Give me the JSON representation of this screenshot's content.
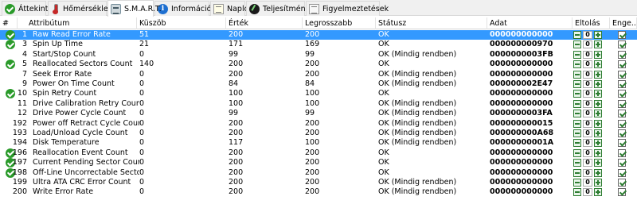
{
  "tabs": [
    {
      "label": "Áttekintés",
      "icon": "check-circle-icon",
      "active": false
    },
    {
      "label": "Hőmérséklet",
      "icon": "thermometer-icon",
      "active": false
    },
    {
      "label": "S.M.A.R.T.",
      "icon": "smart-drive-icon",
      "active": true
    },
    {
      "label": "Információk",
      "icon": "info-icon",
      "active": false
    },
    {
      "label": "Napló",
      "icon": "log-icon",
      "active": false
    },
    {
      "label": "Teljesítmény",
      "icon": "performance-icon",
      "active": false
    },
    {
      "label": "Figyelmeztetések",
      "icon": "warnings-icon",
      "active": false
    }
  ],
  "table": {
    "headers": {
      "num": "#",
      "attr": "Attribútum",
      "threshold": "Küszöb",
      "value": "Érték",
      "worst": "Legrosszabb",
      "status": "Státusz",
      "data": "Adat",
      "offset": "Eltolás",
      "enabled": "Enge..."
    },
    "rows": [
      {
        "ok_icon": true,
        "num": "1",
        "attr": "Raw Read Error Rate",
        "threshold": "51",
        "value": "200",
        "worst": "200",
        "status": "OK",
        "data": "000000000000",
        "offset": "0",
        "enabled": true,
        "selected": true
      },
      {
        "ok_icon": true,
        "num": "3",
        "attr": "Spin Up Time",
        "threshold": "21",
        "value": "171",
        "worst": "169",
        "status": "OK",
        "data": "000000000970",
        "offset": "0",
        "enabled": true
      },
      {
        "ok_icon": false,
        "num": "4",
        "attr": "Start/Stop Count",
        "threshold": "0",
        "value": "99",
        "worst": "99",
        "status": "OK (Mindig rendben)",
        "data": "0000000003FB",
        "offset": "0",
        "enabled": true
      },
      {
        "ok_icon": true,
        "num": "5",
        "attr": "Reallocated Sectors Count",
        "threshold": "140",
        "value": "200",
        "worst": "200",
        "status": "OK",
        "data": "000000000000",
        "offset": "0",
        "enabled": true
      },
      {
        "ok_icon": false,
        "num": "7",
        "attr": "Seek Error Rate",
        "threshold": "0",
        "value": "200",
        "worst": "200",
        "status": "OK (Mindig rendben)",
        "data": "000000000000",
        "offset": "0",
        "enabled": true
      },
      {
        "ok_icon": false,
        "num": "9",
        "attr": "Power On Time Count",
        "threshold": "0",
        "value": "84",
        "worst": "84",
        "status": "OK (Mindig rendben)",
        "data": "000000002E47",
        "offset": "0",
        "enabled": true
      },
      {
        "ok_icon": true,
        "num": "10",
        "attr": "Spin Retry Count",
        "threshold": "0",
        "value": "100",
        "worst": "100",
        "status": "OK",
        "data": "000000000000",
        "offset": "0",
        "enabled": true
      },
      {
        "ok_icon": false,
        "num": "11",
        "attr": "Drive Calibration Retry Count",
        "threshold": "0",
        "value": "100",
        "worst": "100",
        "status": "OK (Mindig rendben)",
        "data": "000000000000",
        "offset": "0",
        "enabled": true
      },
      {
        "ok_icon": false,
        "num": "12",
        "attr": "Drive Power Cycle Count",
        "threshold": "0",
        "value": "99",
        "worst": "99",
        "status": "OK (Mindig rendben)",
        "data": "0000000003FA",
        "offset": "0",
        "enabled": true
      },
      {
        "ok_icon": false,
        "num": "192",
        "attr": "Power off Retract Cycle Count",
        "threshold": "0",
        "value": "200",
        "worst": "200",
        "status": "OK (Mindig rendben)",
        "data": "000000000015",
        "offset": "0",
        "enabled": true
      },
      {
        "ok_icon": false,
        "num": "193",
        "attr": "Load/Unload Cycle Count",
        "threshold": "0",
        "value": "200",
        "worst": "200",
        "status": "OK (Mindig rendben)",
        "data": "000000000A68",
        "offset": "0",
        "enabled": true
      },
      {
        "ok_icon": false,
        "num": "194",
        "attr": "Disk Temperature",
        "threshold": "0",
        "value": "117",
        "worst": "100",
        "status": "OK (Mindig rendben)",
        "data": "00000000001A",
        "offset": "0",
        "enabled": true
      },
      {
        "ok_icon": true,
        "num": "196",
        "attr": "Reallocation Event Count",
        "threshold": "0",
        "value": "200",
        "worst": "200",
        "status": "OK",
        "data": "000000000000",
        "offset": "0",
        "enabled": true
      },
      {
        "ok_icon": true,
        "num": "197",
        "attr": "Current Pending Sector Count",
        "threshold": "0",
        "value": "200",
        "worst": "200",
        "status": "OK",
        "data": "000000000000",
        "offset": "0",
        "enabled": true
      },
      {
        "ok_icon": true,
        "num": "198",
        "attr": "Off-Line Uncorrectable Sector Count",
        "threshold": "0",
        "value": "200",
        "worst": "200",
        "status": "OK",
        "data": "000000000000",
        "offset": "0",
        "enabled": true
      },
      {
        "ok_icon": false,
        "num": "199",
        "attr": "Ultra ATA CRC Error Count",
        "threshold": "0",
        "value": "200",
        "worst": "200",
        "status": "OK (Mindig rendben)",
        "data": "000000000000",
        "offset": "0",
        "enabled": true
      },
      {
        "ok_icon": false,
        "num": "200",
        "attr": "Write Error Rate",
        "threshold": "0",
        "value": "200",
        "worst": "200",
        "status": "OK (Mindig rendben)",
        "data": "000000000000",
        "offset": "0",
        "enabled": true
      }
    ]
  }
}
